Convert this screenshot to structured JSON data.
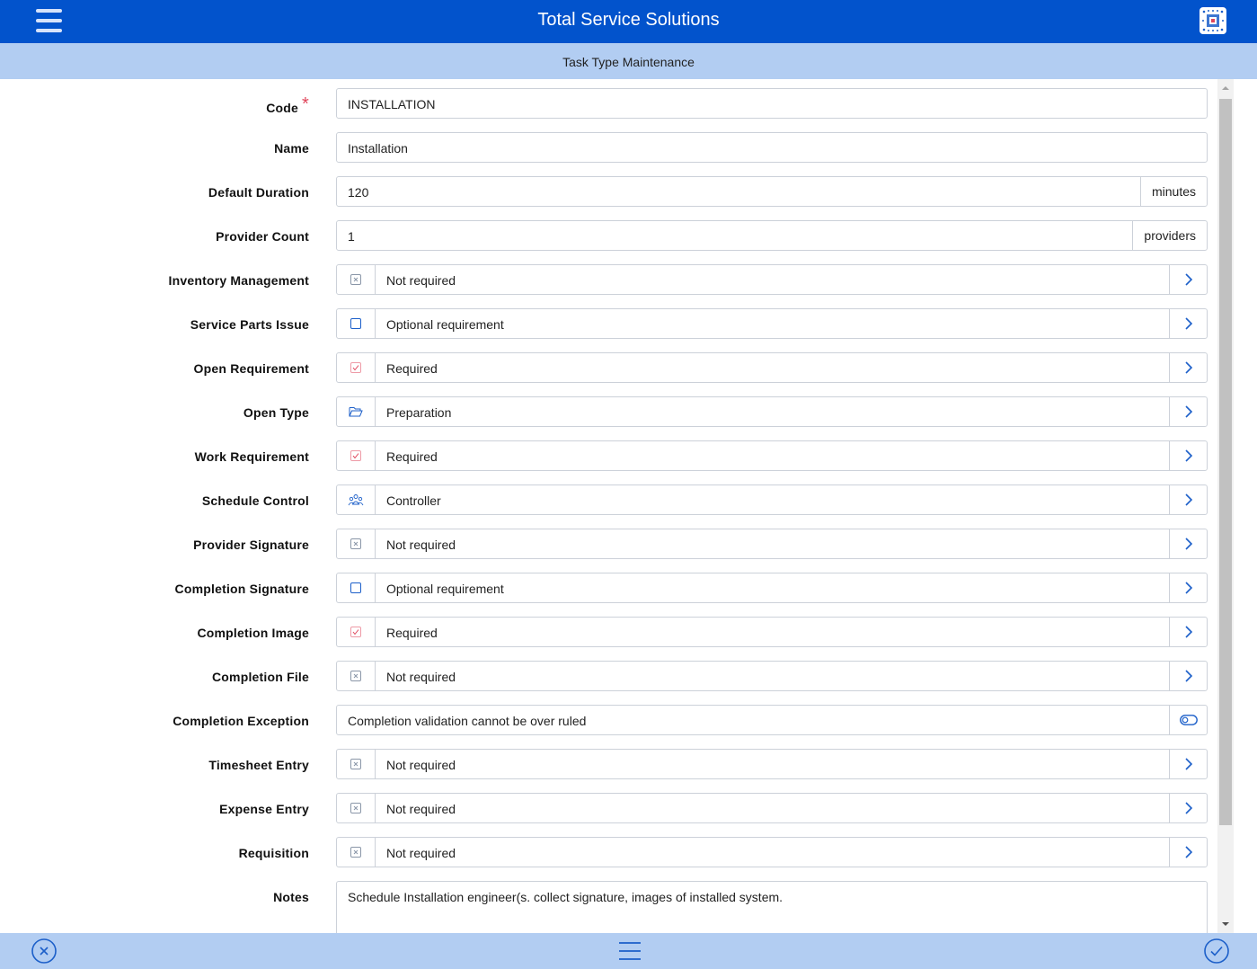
{
  "header": {
    "title": "Total Service Solutions"
  },
  "subheader": {
    "title": "Task Type Maintenance"
  },
  "form": {
    "code": {
      "label": "Code",
      "required_mark": "*",
      "value": "INSTALLATION"
    },
    "name": {
      "label": "Name",
      "value": "Installation"
    },
    "default_duration": {
      "label": "Default Duration",
      "value": "120",
      "suffix": "minutes"
    },
    "provider_count": {
      "label": "Provider Count",
      "value": "1",
      "suffix": "providers"
    },
    "inventory_management": {
      "label": "Inventory Management",
      "value": "Not required",
      "icon": "x-box-icon"
    },
    "service_parts_issue": {
      "label": "Service Parts Issue",
      "value": "Optional requirement",
      "icon": "empty-box-icon"
    },
    "open_requirement": {
      "label": "Open Requirement",
      "value": "Required",
      "icon": "check-box-icon"
    },
    "open_type": {
      "label": "Open Type",
      "value": "Preparation",
      "icon": "folder-open-icon"
    },
    "work_requirement": {
      "label": "Work Requirement",
      "value": "Required",
      "icon": "check-box-icon"
    },
    "schedule_control": {
      "label": "Schedule Control",
      "value": "Controller",
      "icon": "users-icon"
    },
    "provider_signature": {
      "label": "Provider Signature",
      "value": "Not required",
      "icon": "x-box-icon"
    },
    "completion_signature": {
      "label": "Completion Signature",
      "value": "Optional requirement",
      "icon": "empty-box-icon"
    },
    "completion_image": {
      "label": "Completion Image",
      "value": "Required",
      "icon": "check-box-icon"
    },
    "completion_file": {
      "label": "Completion File",
      "value": "Not required",
      "icon": "x-box-icon"
    },
    "completion_exception": {
      "label": "Completion Exception",
      "value": "Completion validation cannot be over ruled",
      "toggle_on": false
    },
    "timesheet_entry": {
      "label": "Timesheet Entry",
      "value": "Not required",
      "icon": "x-box-icon"
    },
    "expense_entry": {
      "label": "Expense Entry",
      "value": "Not required",
      "icon": "x-box-icon"
    },
    "requisition": {
      "label": "Requisition",
      "value": "Not required",
      "icon": "x-box-icon"
    },
    "notes": {
      "label": "Notes",
      "value": "Schedule Installation engineer(s. collect signature, images of installed system."
    }
  },
  "colors": {
    "header": "#0253cc",
    "subheader": "#b2cdf2",
    "accent": "#1c5fc9",
    "required": "#e0455b"
  }
}
